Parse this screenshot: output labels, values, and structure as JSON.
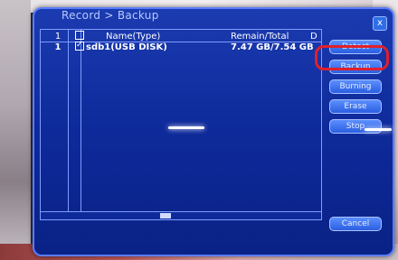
{
  "window": {
    "title": "Record > Backup",
    "close": "x"
  },
  "table": {
    "headers": {
      "index": "1",
      "name": "Name(Type)",
      "remain": "Remain/Total",
      "end": "D"
    },
    "rows": [
      {
        "index": "1",
        "checked": true,
        "name": "sdb1(USB DISK)",
        "remain": "7.47 GB/7.54 GB"
      }
    ]
  },
  "scrollbar": {
    "thumb": "III"
  },
  "buttons": {
    "detect": "Detect",
    "backup": "Backup",
    "burning": "Burning",
    "erase": "Erase",
    "stop": "Stop",
    "cancel": "Cancel"
  },
  "colors": {
    "window": "#0e2a9a",
    "accent": "#5b8fff",
    "highlight": "#e0202a"
  }
}
